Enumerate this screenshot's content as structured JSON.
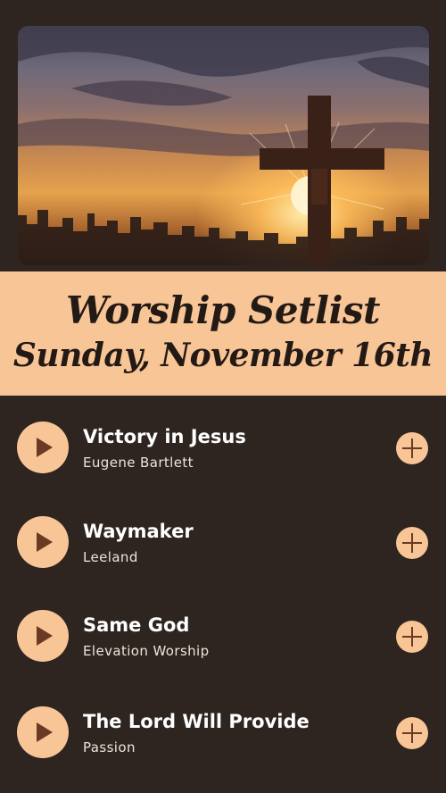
{
  "hero": {
    "image": "sunset-cross-photo"
  },
  "header": {
    "title": "Worship Setlist",
    "date": "Sunday, November 16th"
  },
  "songs": [
    {
      "title": "Victory in Jesus",
      "artist": "Eugene Bartlett"
    },
    {
      "title": "Waymaker",
      "artist": "Leeland"
    },
    {
      "title": "Same God",
      "artist": "Elevation Worship"
    },
    {
      "title": "The Lord Will Provide",
      "artist": "Passion"
    }
  ],
  "icons": {
    "play": "play-icon",
    "add": "plus-icon"
  },
  "colors": {
    "background": "#2e2420",
    "accent": "#f8c596",
    "icon": "#6b3a24",
    "text": "#ffffff"
  }
}
